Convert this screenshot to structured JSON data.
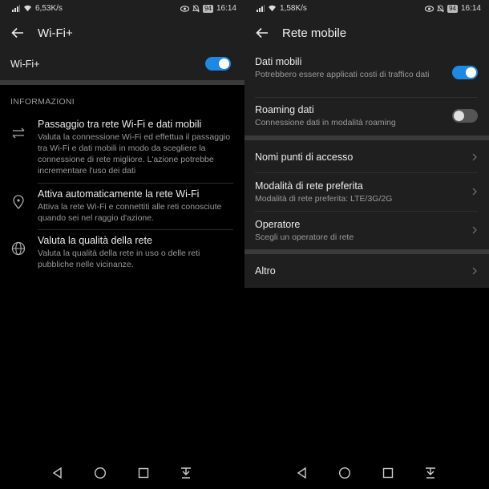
{
  "left": {
    "status": {
      "speed": "6,53K/s",
      "battery": "94",
      "time": "16:14"
    },
    "appbar": {
      "title": "Wi-Fi+"
    },
    "main_toggle": {
      "label": "Wi-Fi+",
      "on": true
    },
    "section_caption": "INFORMAZIONI",
    "info_items": [
      {
        "icon": "swap-arrows-icon",
        "title": "Passaggio tra rete Wi-Fi e dati mobili",
        "description": "Valuta la connessione Wi-Fi ed effettua il passaggio tra Wi-Fi e dati mobili in modo da scegliere la connessione di rete migliore. L'azione potrebbe incrementare l'uso dei dati"
      },
      {
        "icon": "location-pin-icon",
        "title": "Attiva automaticamente la rete Wi-Fi",
        "description": "Attiva la rete Wi-Fi e connettiti alle reti conosciute quando sei nel raggio d'azione."
      },
      {
        "icon": "globe-icon",
        "title": "Valuta la qualità della rete",
        "description": "Valuta la qualità della rete in uso o delle reti pubbliche nelle vicinanze."
      }
    ]
  },
  "right": {
    "status": {
      "speed": "1,58K/s",
      "battery": "94",
      "time": "16:14"
    },
    "appbar": {
      "title": "Rete mobile"
    },
    "toggles": [
      {
        "title": "Dati mobili",
        "subtitle": "Potrebbero essere applicati costi di traffico dati",
        "on": true
      },
      {
        "title": "Roaming dati",
        "subtitle": "Connessione dati in modalità roaming",
        "on": false
      }
    ],
    "nav_items": [
      {
        "title": "Nomi punti di accesso",
        "subtitle": ""
      },
      {
        "title": "Modalità di rete preferita",
        "subtitle": "Modalità di rete preferita: LTE/3G/2G"
      },
      {
        "title": "Operatore",
        "subtitle": "Scegli un operatore di rete"
      }
    ],
    "more": {
      "title": "Altro"
    }
  },
  "colors": {
    "accent": "#1e88e5",
    "surface": "#1f1f1f",
    "background": "#000000"
  }
}
